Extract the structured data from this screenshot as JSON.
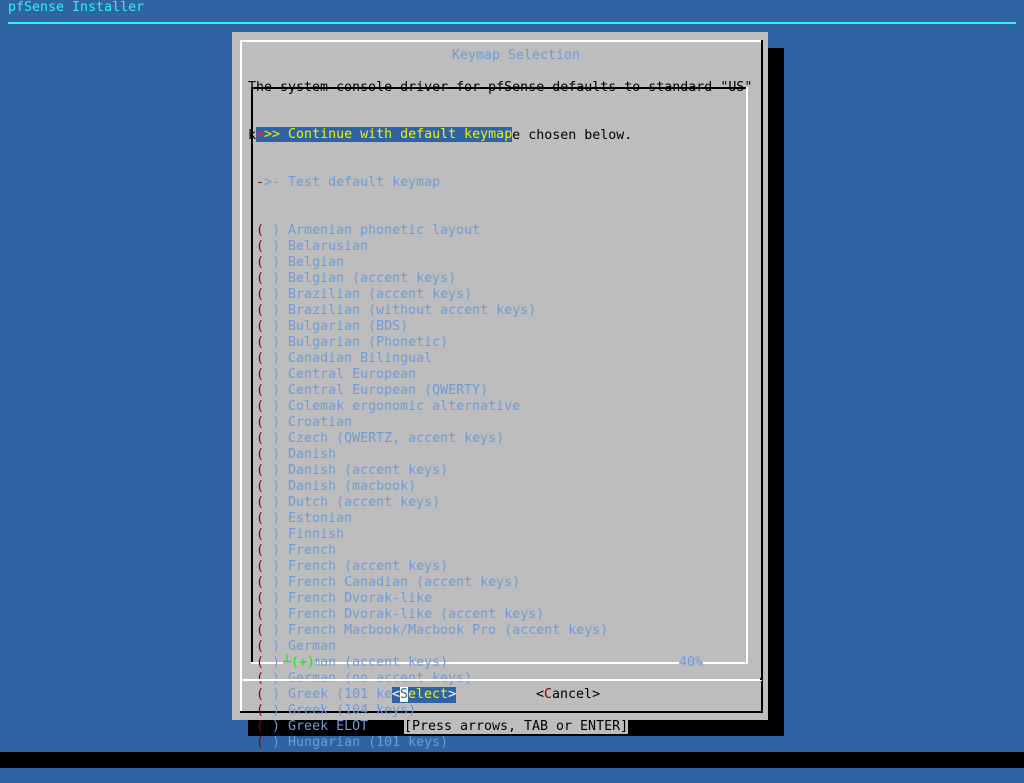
{
  "backtitle": "pfSense Installer",
  "dialog": {
    "title": "Keymap Selection",
    "prompt_lines": [
      "The system console driver for pfSense defaults to standard \"US\"",
      "keyboard map. Other keymaps can be chosen below."
    ],
    "selected_item": {
      "marker_first": ">",
      "marker_rest": ">> ",
      "label": "Continue with default keymap"
    },
    "test_item": {
      "marker_dash": "-",
      "marker_rest": ">- ",
      "label": "Test default keymap"
    },
    "radio_items": [
      "Armenian phonetic layout",
      "Belarusian",
      "Belgian",
      "Belgian (accent keys)",
      "Brazilian (accent keys)",
      "Brazilian (without accent keys)",
      "Bulgarian (BDS)",
      "Bulgarian (Phonetic)",
      "Canadian Bilingual",
      "Central European",
      "Central European (QWERTY)",
      "Colemak ergonomic alternative",
      "Croatian",
      "Czech (QWERTZ, accent keys)",
      "Danish",
      "Danish (accent keys)",
      "Danish (macbook)",
      "Dutch (accent keys)",
      "Estonian",
      "Finnish",
      "French",
      "French (accent keys)",
      "French Canadian (accent keys)",
      "French Dvorak-like",
      "French Dvorak-like (accent keys)",
      "French Macbook/Macbook Pro (accent keys)",
      "German",
      "German (accent keys)",
      "German (no accent keys)",
      "Greek (101 keys)",
      "Greek (104 keys)",
      "Greek ELOT",
      "Hungarian (101 keys)"
    ],
    "radio_open": "(",
    "radio_close": " ) ",
    "more_indicator": "┴(+)",
    "scroll_percent": "40%",
    "buttons": {
      "select": {
        "open": "<",
        "hotkey": "S",
        "rest": "elect",
        "close": ">"
      },
      "cancel": {
        "open": "<",
        "hotkey": "C",
        "rest": "ancel",
        "close": ">"
      }
    },
    "hint": "[Press arrows, TAB or ENTER]"
  }
}
